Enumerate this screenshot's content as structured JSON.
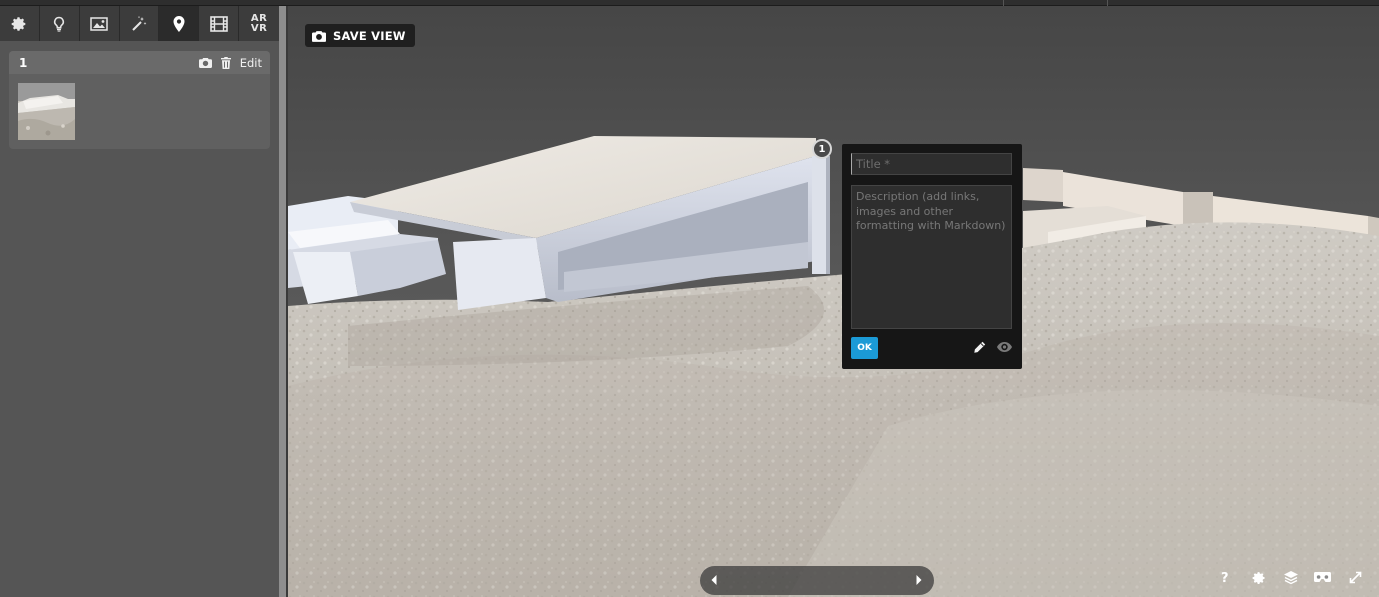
{
  "toolbar": {
    "tools": [
      {
        "name": "gear-icon",
        "active": false
      },
      {
        "name": "lightbulb-icon",
        "active": false
      },
      {
        "name": "image-icon",
        "active": false
      },
      {
        "name": "magic-wand-icon",
        "active": false
      },
      {
        "name": "map-pin-icon",
        "active": true
      },
      {
        "name": "film-icon",
        "active": false
      },
      {
        "name": "ar-vr-icon",
        "active": false
      }
    ],
    "arvr_line1": "AR",
    "arvr_line2": "VR"
  },
  "annotation": {
    "number": "1",
    "edit_label": "Edit",
    "icons": [
      "camera-icon",
      "trash-icon"
    ]
  },
  "viewport": {
    "save_view_label": "SAVE VIEW",
    "hotspot_number": "1",
    "editor": {
      "title_placeholder": "Title *",
      "description_placeholder": "Description (add links, images and other formatting with Markdown)",
      "ok_label": "OK",
      "icons": [
        "pencil-icon",
        "eye-icon"
      ]
    },
    "bottom_right_icons": [
      "help-icon",
      "settings-icon",
      "layers-icon",
      "vr-headset-icon",
      "fullscreen-icon"
    ],
    "help_label": "?"
  },
  "colors": {
    "accent": "#1b9ad6",
    "panel": "#555555",
    "toolbar": "#3c3c3c",
    "popup": "#161616"
  }
}
